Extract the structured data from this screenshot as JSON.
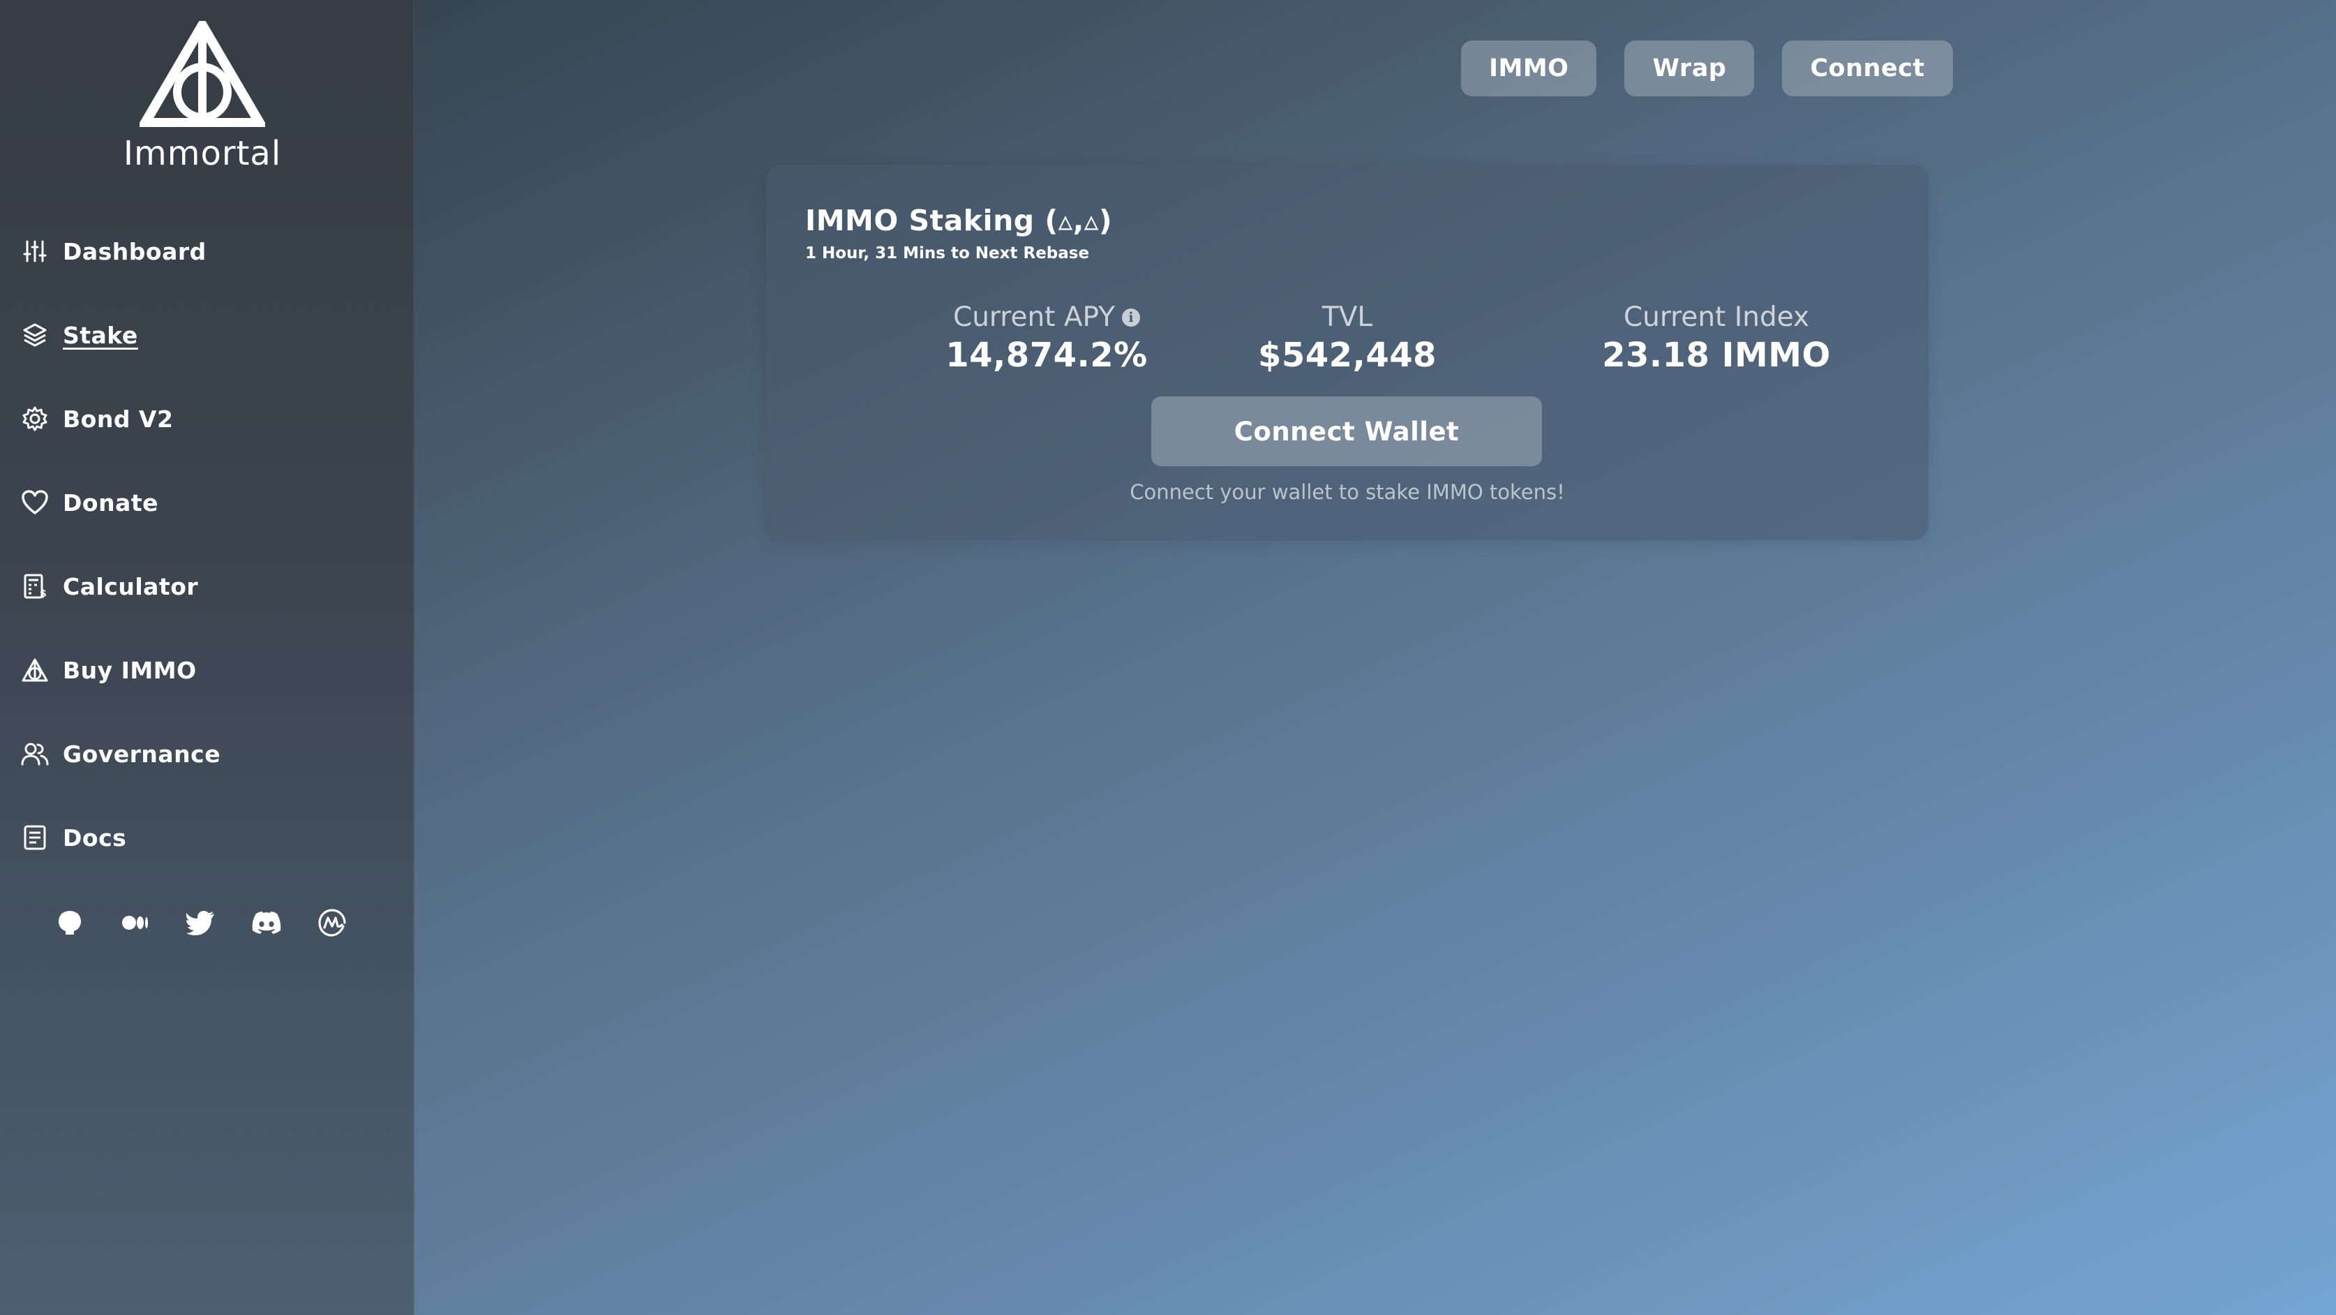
{
  "brand": {
    "name": "Immortal",
    "logo_icon": "deathly-hallows-icon"
  },
  "sidebar": {
    "items": [
      {
        "label": "Dashboard",
        "icon": "sliders-icon",
        "active": false
      },
      {
        "label": "Stake",
        "icon": "layers-icon",
        "active": true
      },
      {
        "label": "Bond V2",
        "icon": "gear-icon",
        "active": false
      },
      {
        "label": "Donate",
        "icon": "heart-icon",
        "active": false
      },
      {
        "label": "Calculator",
        "icon": "calculator-icon",
        "active": false
      },
      {
        "label": "Buy IMMO",
        "icon": "hallows-icon",
        "active": false
      },
      {
        "label": "Governance",
        "icon": "users-icon",
        "active": false
      },
      {
        "label": "Docs",
        "icon": "document-icon",
        "active": false
      }
    ],
    "socials": [
      "github-icon",
      "medium-icon",
      "twitter-icon",
      "discord-icon",
      "coinmarketcap-icon"
    ]
  },
  "topbar": {
    "immo": "IMMO",
    "wrap": "Wrap",
    "connect": "Connect"
  },
  "card": {
    "title": "IMMO Staking (▵,▵)",
    "subtitle": "1 Hour, 31 Mins to Next Rebase",
    "apy_label": "Current APY",
    "apy_value": "14,874.2%",
    "tvl_label": "TVL",
    "tvl_value": "$542,448",
    "index_label": "Current Index",
    "index_value": "23.18 IMMO",
    "connect_wallet": "Connect Wallet",
    "hint": "Connect your wallet to stake IMMO tokens!"
  },
  "colors": {
    "sidebar_bg": "#3a424c",
    "page_gradient_end": "#74a6d3",
    "button_bg": "#8c99a6"
  }
}
